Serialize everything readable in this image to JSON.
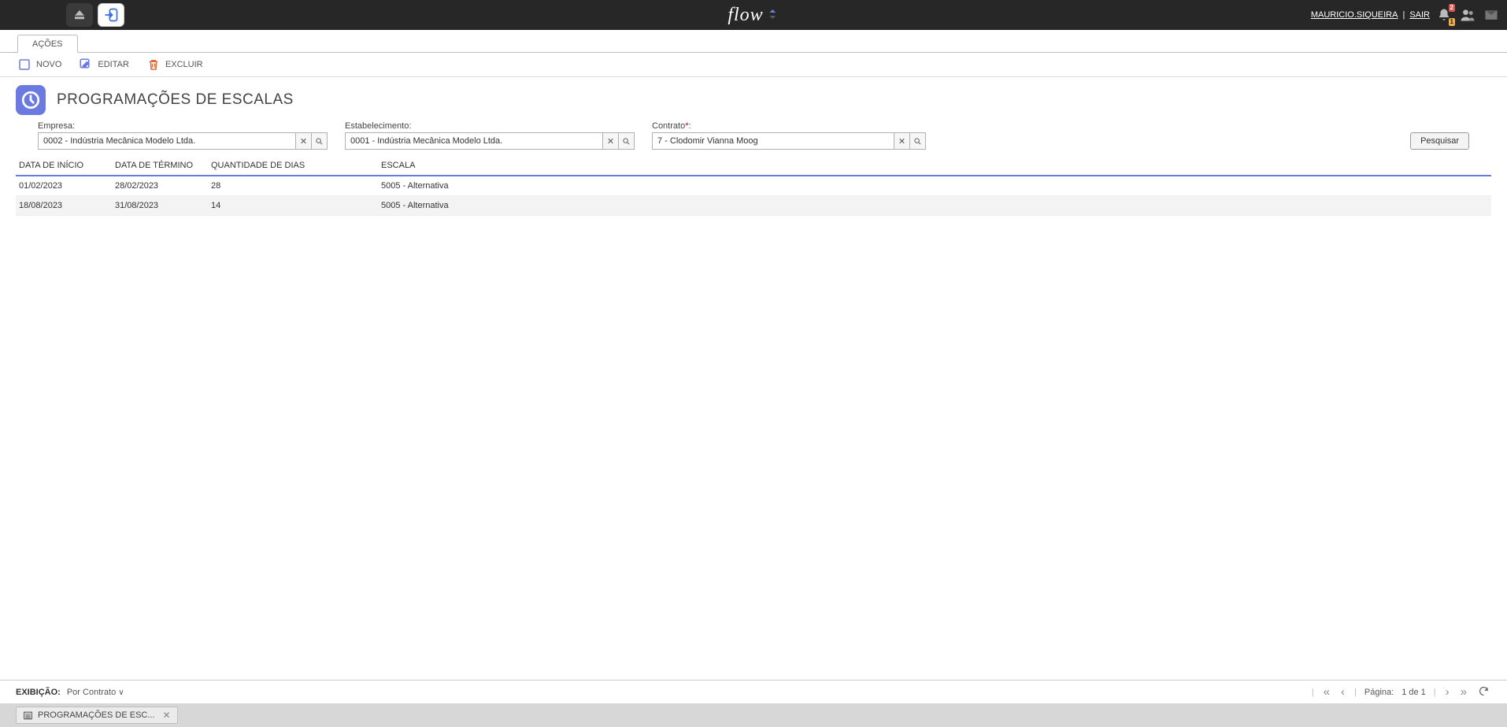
{
  "header": {
    "logo_text": "flow",
    "user_name": "MAURICIO.SIQUEIRA",
    "logout_label": "SAIR",
    "notif_count_top": "2",
    "notif_count_bottom": "1"
  },
  "tabs": {
    "main_tab": "AÇÕES"
  },
  "toolbar": {
    "novo": "NOVO",
    "editar": "EDITAR",
    "excluir": "EXCLUIR"
  },
  "page": {
    "title": "PROGRAMAÇÕES DE ESCALAS"
  },
  "filters": {
    "empresa_label": "Empresa:",
    "empresa_value": "0002 - Indústria Mecânica Modelo Ltda.",
    "estabelecimento_label": "Estabelecimento:",
    "estabelecimento_value": "0001 - Indústria Mecânica Modelo Ltda.",
    "contrato_label": "Contrato",
    "contrato_value": "7 - Clodomir Vianna Moog",
    "search_button": "Pesquisar"
  },
  "grid": {
    "headers": {
      "start": "DATA DE INÍCIO",
      "end": "DATA DE TÉRMINO",
      "days": "QUANTIDADE DE DIAS",
      "scale": "ESCALA"
    },
    "rows": [
      {
        "start": "01/02/2023",
        "end": "28/02/2023",
        "days": "28",
        "scale": "5005 - Alternativa"
      },
      {
        "start": "18/08/2023",
        "end": "31/08/2023",
        "days": "14",
        "scale": "5005 - Alternativa"
      }
    ]
  },
  "footer": {
    "exibicao_label": "EXIBIÇÃO:",
    "exibicao_value": "Por Contrato",
    "page_label": "Página:",
    "page_info": "1 de 1"
  },
  "bottom_tab": {
    "label": "PROGRAMAÇÕES DE ESC..."
  }
}
